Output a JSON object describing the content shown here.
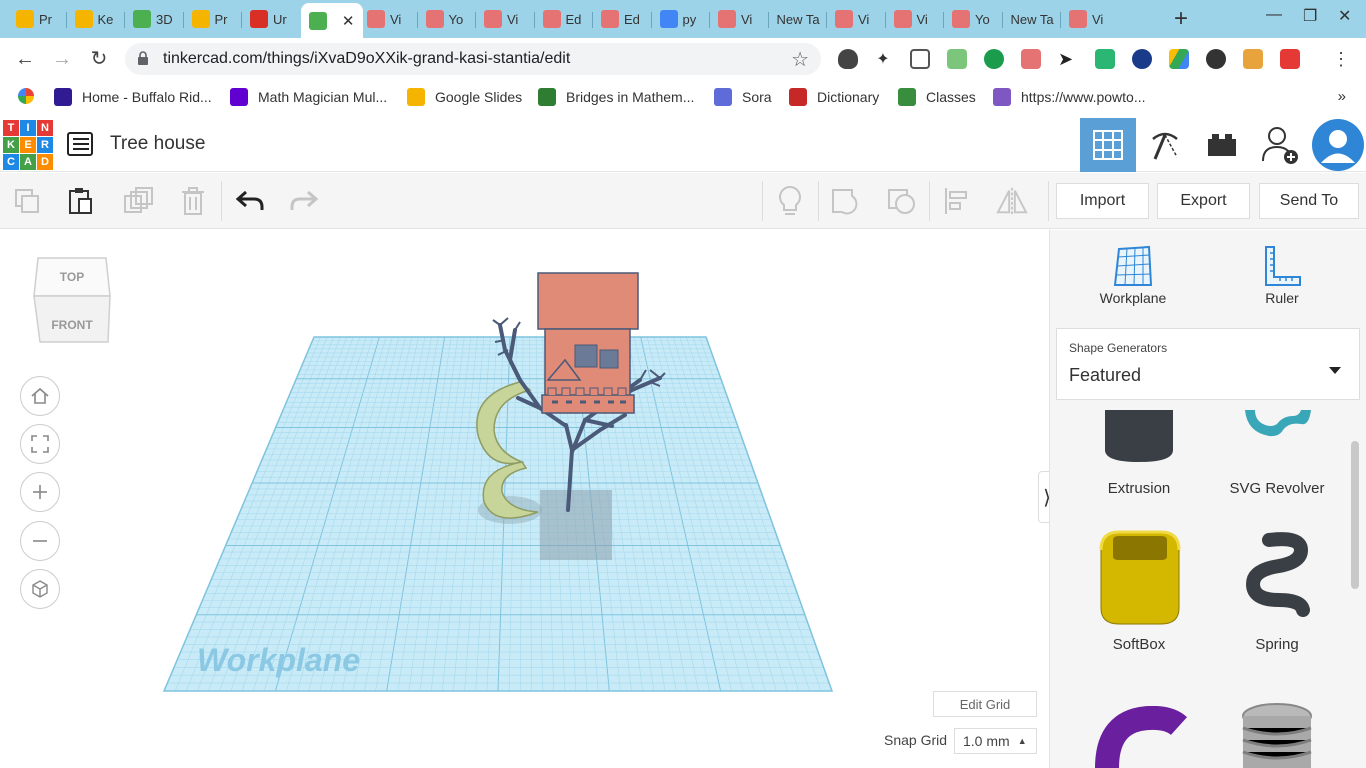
{
  "browser": {
    "tabs": [
      {
        "label": "Pr",
        "color": "#f4b400"
      },
      {
        "label": "Ke",
        "color": "#f4b400"
      },
      {
        "label": "3D",
        "color": "#4caf50"
      },
      {
        "label": "Pr",
        "color": "#f4b400"
      },
      {
        "label": "Ur",
        "color": "#d93025"
      },
      {
        "label": "",
        "color": "#4caf50",
        "active": true
      },
      {
        "label": "Vi",
        "color": "#e57373"
      },
      {
        "label": "Yo",
        "color": "#e57373"
      },
      {
        "label": "Vi",
        "color": "#e57373"
      },
      {
        "label": "Ed",
        "color": "#e57373"
      },
      {
        "label": "Ed",
        "color": "#e57373"
      },
      {
        "label": "py",
        "color": "#4285f4"
      },
      {
        "label": "Vi",
        "color": "#e57373"
      },
      {
        "label": "New Ta",
        "color": ""
      },
      {
        "label": "Vi",
        "color": "#e57373"
      },
      {
        "label": "Vi",
        "color": "#e57373"
      },
      {
        "label": "Yo",
        "color": "#e57373"
      },
      {
        "label": "New Ta",
        "color": ""
      },
      {
        "label": "Vi",
        "color": "#e57373"
      }
    ],
    "new_tab": "+",
    "close_tab": "✕",
    "url": "tinkercad.com/things/iXvaD9oXXik-grand-kasi-stantia/edit",
    "bookmarks": [
      {
        "label": "Home - Buffalo Rid...",
        "color": "#311b92"
      },
      {
        "label": "Math Magician Mul...",
        "color": "#6001d2"
      },
      {
        "label": "Google Slides",
        "color": "#f4b400"
      },
      {
        "label": "Bridges in Mathem...",
        "color": "#2e7d32"
      },
      {
        "label": "Sora",
        "color": "#5f6bd8"
      },
      {
        "label": "Dictionary",
        "color": "#c62828"
      },
      {
        "label": "Classes",
        "color": "#388e3c"
      },
      {
        "label": "https://www.powto...",
        "color": "#7e57c2"
      }
    ],
    "bookmarks_more": "»"
  },
  "app": {
    "logo_letters": [
      "T",
      "I",
      "N",
      "K",
      "E",
      "R",
      "C",
      "A",
      "D"
    ],
    "project_title": "Tree house",
    "buttons": {
      "import": "Import",
      "export": "Export",
      "send_to": "Send To"
    }
  },
  "viewport": {
    "viewcube_top": "TOP",
    "viewcube_front": "FRONT",
    "workplane_label": "Workplane",
    "edit_grid": "Edit Grid",
    "snap_grid_label": "Snap Grid",
    "snap_grid_value": "1.0 mm"
  },
  "panel": {
    "tools": {
      "workplane": "Workplane",
      "ruler": "Ruler"
    },
    "shape_generators_label": "Shape Generators",
    "shape_generators_value": "Featured",
    "shapes": [
      {
        "name": "Extrusion",
        "icon": "extrusion-shape-icon"
      },
      {
        "name": "SVG Revolver",
        "icon": "svg-revolver-shape-icon"
      },
      {
        "name": "SoftBox",
        "icon": "softbox-shape-icon"
      },
      {
        "name": "Spring",
        "icon": "spring-shape-icon"
      },
      {
        "name": "",
        "icon": "pipe-bend-shape-icon"
      },
      {
        "name": "",
        "icon": "screw-shape-icon"
      }
    ]
  },
  "colors": {
    "tab_strip": "#9dd3e8",
    "accent_blue": "#5a9fd6",
    "workplane_grid": "#8fd0eb",
    "house": "#e08a78",
    "tree": "#4a5a78",
    "slide": "#c7d59a",
    "softbox": "#d4b800"
  }
}
